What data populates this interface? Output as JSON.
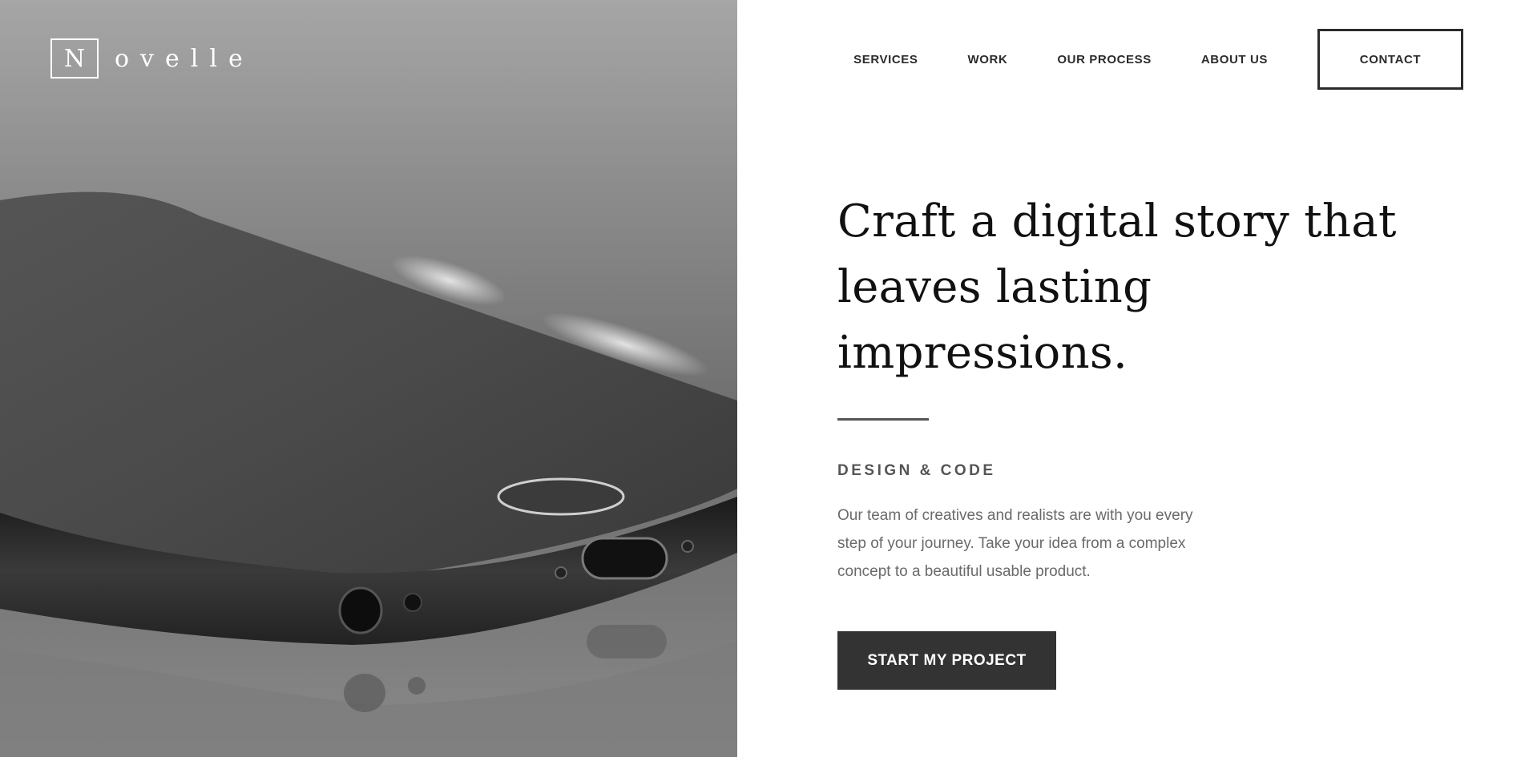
{
  "brand": {
    "logo_initial": "N",
    "logo_rest": "ovelle"
  },
  "nav": {
    "items": [
      {
        "label": "SERVICES"
      },
      {
        "label": "WORK"
      },
      {
        "label": "OUR PROCESS"
      },
      {
        "label": "ABOUT US"
      }
    ],
    "contact_label": "CONTACT"
  },
  "hero": {
    "headline_line1": "Craft a digital story that",
    "headline_line2": "leaves lasting impressions.",
    "eyebrow": "DESIGN & CODE",
    "body_line1": "Our team of creatives and realists are with you every",
    "body_line2": "step of your journey. Take your idea from a complex",
    "body_line3": "concept to a beautiful usable product.",
    "cta_label": "START MY PROJECT"
  },
  "colors": {
    "text_dark": "#111111",
    "nav_text": "#2b2b2b",
    "cta_bg": "#333333",
    "body_text": "#6a6a6a"
  }
}
